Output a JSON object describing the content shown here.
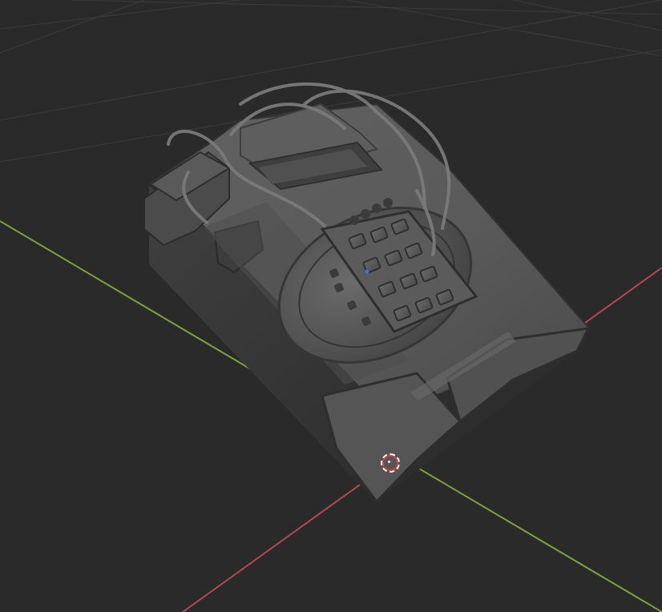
{
  "viewport": {
    "background": "#2a2a2a",
    "grid_color": "#3b3b3b",
    "x_axis_color": "#b3475a",
    "y_axis_color": "#7fa03b"
  },
  "object": {
    "name": "keypad-device",
    "keypad_keys": 12
  },
  "cursor": {
    "icon": "3d-cursor-icon",
    "color_primary": "#ffffff",
    "color_secondary": "#d53b3b"
  }
}
